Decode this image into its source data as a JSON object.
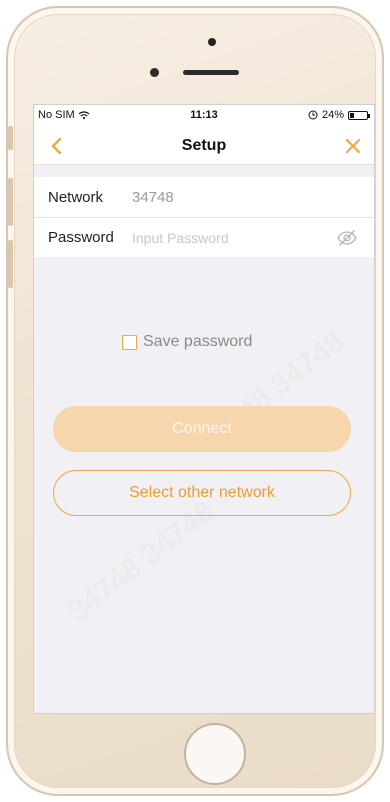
{
  "status_bar": {
    "carrier": "No SIM",
    "time": "11:13",
    "battery_percent_text": "24%",
    "battery_level": 0.24
  },
  "nav": {
    "title": "Setup"
  },
  "form": {
    "network_label": "Network",
    "network_value": "34748",
    "password_label": "Password",
    "password_placeholder": "Input Password"
  },
  "save_password_label": "Save password",
  "connect_label": "Connect",
  "select_other_label": "Select other network",
  "colors": {
    "accent": "#f0a94a",
    "connect_disabled": "#f5d6ad",
    "screen_bg": "#f1f0f4"
  },
  "icons": {
    "back": "chevron-left-icon",
    "close": "close-icon",
    "eye": "eye-slash-icon",
    "wifi": "wifi-icon",
    "alarm": "alarm-icon",
    "battery": "battery-icon"
  }
}
